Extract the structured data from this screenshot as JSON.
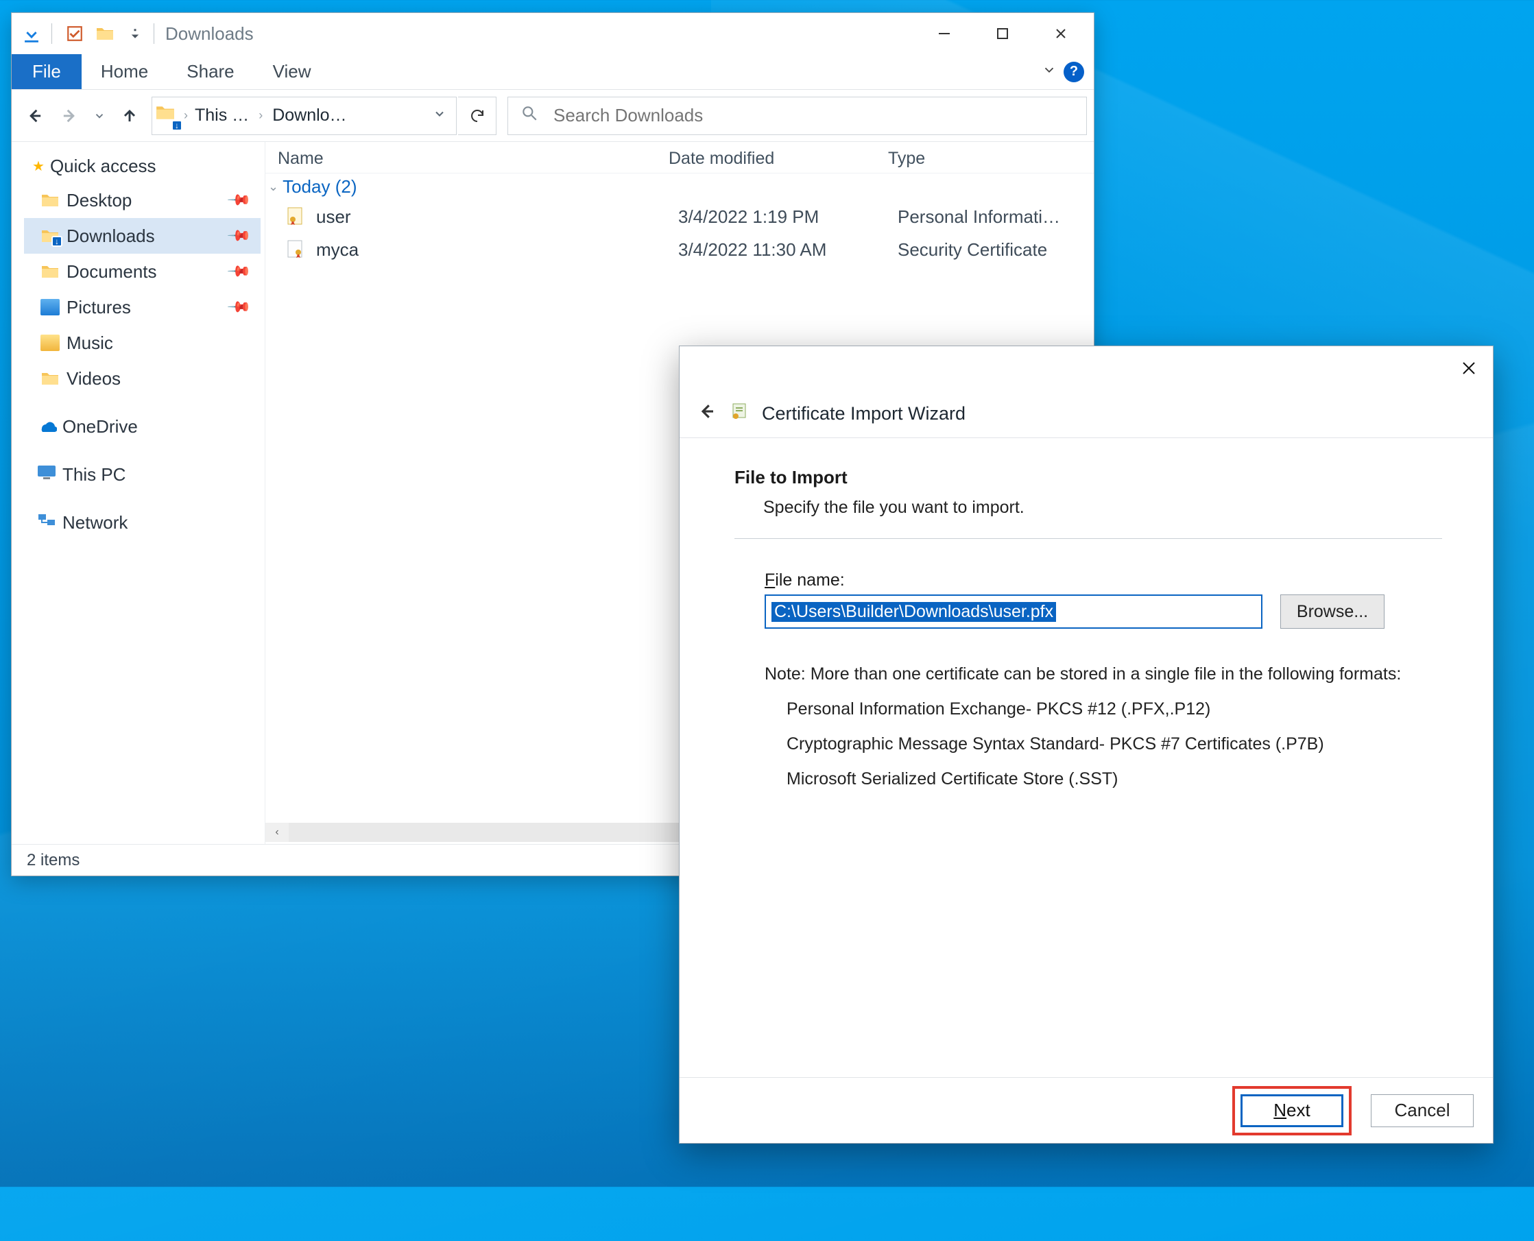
{
  "explorer": {
    "title": "Downloads",
    "tabs": {
      "file": "File",
      "home": "Home",
      "share": "Share",
      "view": "View"
    },
    "breadcrumbs": {
      "thispc": "This …",
      "downloads": "Downlo…"
    },
    "search_placeholder": "Search Downloads",
    "columns": {
      "name": "Name",
      "date": "Date modified",
      "type": "Type"
    },
    "group_label": "Today (2)",
    "files": [
      {
        "name": "user",
        "date": "3/4/2022 1:19 PM",
        "type": "Personal Informati…"
      },
      {
        "name": "myca",
        "date": "3/4/2022 11:30 AM",
        "type": "Security Certificate"
      }
    ],
    "sidebar": {
      "quick_access": "Quick access",
      "items": [
        {
          "label": "Desktop",
          "pinned": true
        },
        {
          "label": "Downloads",
          "pinned": true,
          "selected": true
        },
        {
          "label": "Documents",
          "pinned": true
        },
        {
          "label": "Pictures",
          "pinned": true
        },
        {
          "label": "Music"
        },
        {
          "label": "Videos"
        }
      ],
      "onedrive": "OneDrive",
      "thispc": "This PC",
      "network": "Network"
    },
    "status": "2 items"
  },
  "wizard": {
    "title": "Certificate Import Wizard",
    "section_heading": "File to Import",
    "section_sub": "Specify the file you want to import.",
    "file_label_prefix": "F",
    "file_label_rest": "ile name:",
    "file_value": "C:\\Users\\Builder\\Downloads\\user.pfx",
    "browse": "Browse...",
    "note_label": "Note:  More than one certificate can be stored in a single file in the following formats:",
    "formats": [
      "Personal Information Exchange- PKCS #12 (.PFX,.P12)",
      "Cryptographic Message Syntax Standard- PKCS #7 Certificates (.P7B)",
      "Microsoft Serialized Certificate Store (.SST)"
    ],
    "next_u": "N",
    "next_rest": "ext",
    "cancel": "Cancel"
  }
}
